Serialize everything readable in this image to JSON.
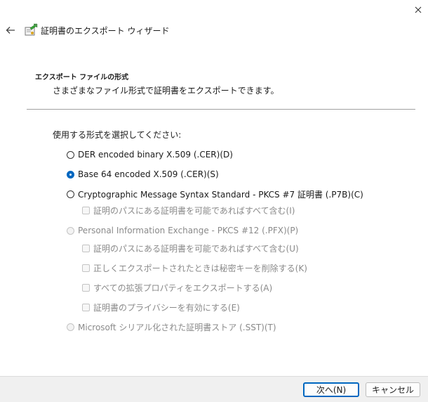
{
  "window": {
    "title": "証明書のエクスポート ウィザード",
    "close_icon": "close-icon",
    "back_icon": "back-arrow-icon"
  },
  "header": {
    "section_title": "エクスポート ファイルの形式",
    "section_desc": "さまざまなファイル形式で証明書をエクスポートできます。"
  },
  "prompt": "使用する形式を選択してください:",
  "options": [
    {
      "type": "radio",
      "label": "DER encoded binary X.509 (.CER)(D)",
      "checked": false,
      "enabled": true
    },
    {
      "type": "radio",
      "label": "Base 64 encoded X.509 (.CER)(S)",
      "checked": true,
      "enabled": true
    },
    {
      "type": "radio",
      "label": "Cryptographic Message Syntax Standard - PKCS #7 証明書 (.P7B)(C)",
      "checked": false,
      "enabled": true
    },
    {
      "type": "checkbox",
      "label": "証明のパスにある証明書を可能であればすべて含む(I)",
      "checked": false,
      "enabled": false
    },
    {
      "type": "radio",
      "label": "Personal Information Exchange - PKCS #12 (.PFX)(P)",
      "checked": false,
      "enabled": false
    },
    {
      "type": "checkbox",
      "label": "証明のパスにある証明書を可能であればすべて含む(U)",
      "checked": false,
      "enabled": false
    },
    {
      "type": "checkbox",
      "label": "正しくエクスポートされたときは秘密キーを削除する(K)",
      "checked": false,
      "enabled": false
    },
    {
      "type": "checkbox",
      "label": "すべての拡張プロパティをエクスポートする(A)",
      "checked": false,
      "enabled": false
    },
    {
      "type": "checkbox",
      "label": "証明書のプライバシーを有効にする(E)",
      "checked": false,
      "enabled": false
    },
    {
      "type": "radio",
      "label": "Microsoft シリアル化された証明書ストア (.SST)(T)",
      "checked": false,
      "enabled": false
    }
  ],
  "buttons": {
    "next": "次へ(N)",
    "cancel": "キャンセル"
  },
  "colors": {
    "accent": "#0067c0",
    "footer_bg": "#f0f0f0",
    "disabled_text": "#8a8a8a"
  }
}
